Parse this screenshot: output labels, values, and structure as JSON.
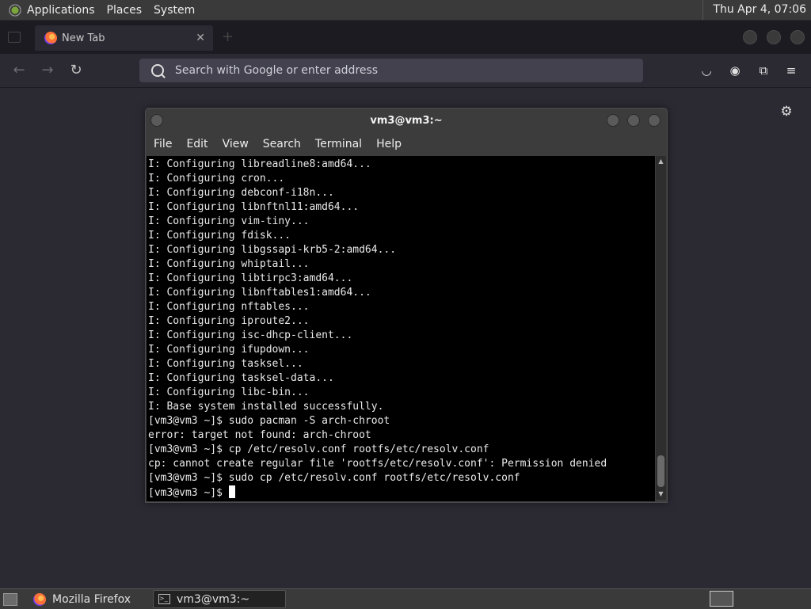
{
  "top_panel": {
    "menus": [
      "Applications",
      "Places",
      "System"
    ],
    "clock": "Thu Apr  4, 07:06"
  },
  "browser": {
    "tab_title": "New Tab",
    "url_placeholder": "Search with Google or enter address"
  },
  "terminal": {
    "title": "vm3@vm3:~",
    "menu": [
      "File",
      "Edit",
      "View",
      "Search",
      "Terminal",
      "Help"
    ],
    "lines": [
      "I: Configuring libreadline8:amd64...",
      "I: Configuring cron...",
      "I: Configuring debconf-i18n...",
      "I: Configuring libnftnl11:amd64...",
      "I: Configuring vim-tiny...",
      "I: Configuring fdisk...",
      "I: Configuring libgssapi-krb5-2:amd64...",
      "I: Configuring whiptail...",
      "I: Configuring libtirpc3:amd64...",
      "I: Configuring libnftables1:amd64...",
      "I: Configuring nftables...",
      "I: Configuring iproute2...",
      "I: Configuring isc-dhcp-client...",
      "I: Configuring ifupdown...",
      "I: Configuring tasksel...",
      "I: Configuring tasksel-data...",
      "I: Configuring libc-bin...",
      "I: Base system installed successfully.",
      "[vm3@vm3 ~]$ sudo pacman -S arch-chroot",
      "error: target not found: arch-chroot",
      "[vm3@vm3 ~]$ cp /etc/resolv.conf rootfs/etc/resolv.conf",
      "cp: cannot create regular file 'rootfs/etc/resolv.conf': Permission denied",
      "[vm3@vm3 ~]$ sudo cp /etc/resolv.conf rootfs/etc/resolv.conf"
    ],
    "prompt": "[vm3@vm3 ~]$ "
  },
  "taskbar": {
    "items": [
      "Mozilla Firefox",
      "vm3@vm3:~"
    ]
  }
}
